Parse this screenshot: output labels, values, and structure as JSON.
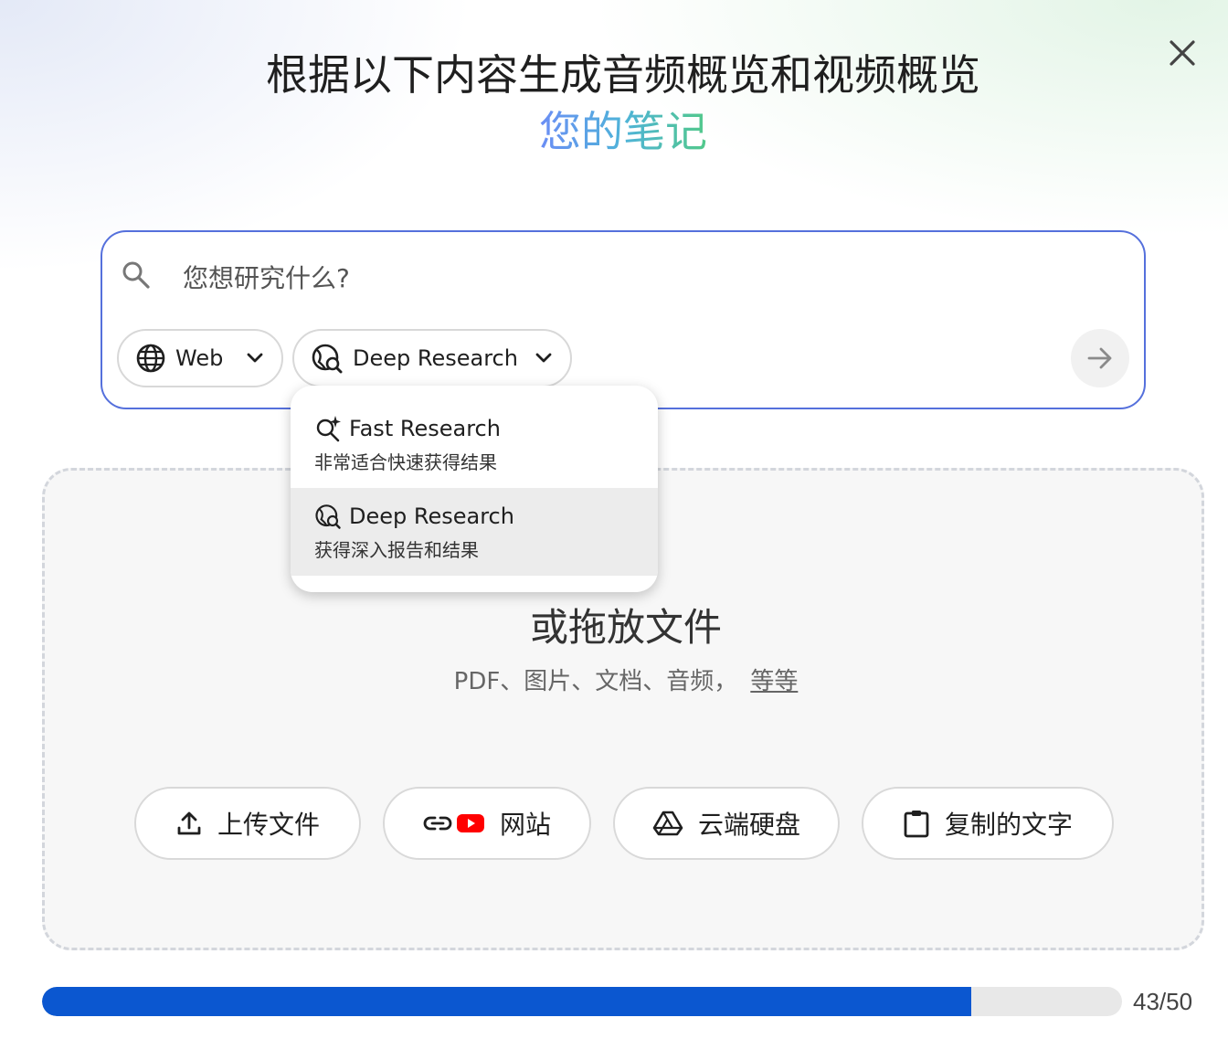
{
  "dialog": {
    "title": "根据以下内容生成音频概览和视频概览",
    "subtitle": "您的笔记"
  },
  "search": {
    "placeholder": "您想研究什么?",
    "value": "",
    "source_chip": {
      "label": "Web",
      "icon": "globe-icon"
    },
    "mode_chip": {
      "label": "Deep Research",
      "icon": "deep-research-icon"
    },
    "send_icon": "arrow-right-icon"
  },
  "mode_dropdown": {
    "items": [
      {
        "label": "Fast Research",
        "description": "非常适合快速获得结果",
        "icon": "fast-research-icon",
        "selected": false
      },
      {
        "label": "Deep Research",
        "description": "获得深入报告和结果",
        "icon": "deep-research-icon",
        "selected": true
      }
    ]
  },
  "drop_zone": {
    "title": "或拖放文件",
    "formats": "PDF、图片、文档、音频，",
    "more_link": "等等",
    "sources": [
      {
        "label": "上传文件",
        "icon": "upload-icon"
      },
      {
        "label": "网站",
        "icon": "link-youtube-icon"
      },
      {
        "label": "云端硬盘",
        "icon": "drive-icon"
      },
      {
        "label": "复制的文字",
        "icon": "clipboard-icon"
      }
    ]
  },
  "source_limit": {
    "used": 43,
    "max": 50,
    "label": "43/50"
  },
  "colors": {
    "accent": "#0b57d0",
    "border_focus": "#5570dc"
  }
}
